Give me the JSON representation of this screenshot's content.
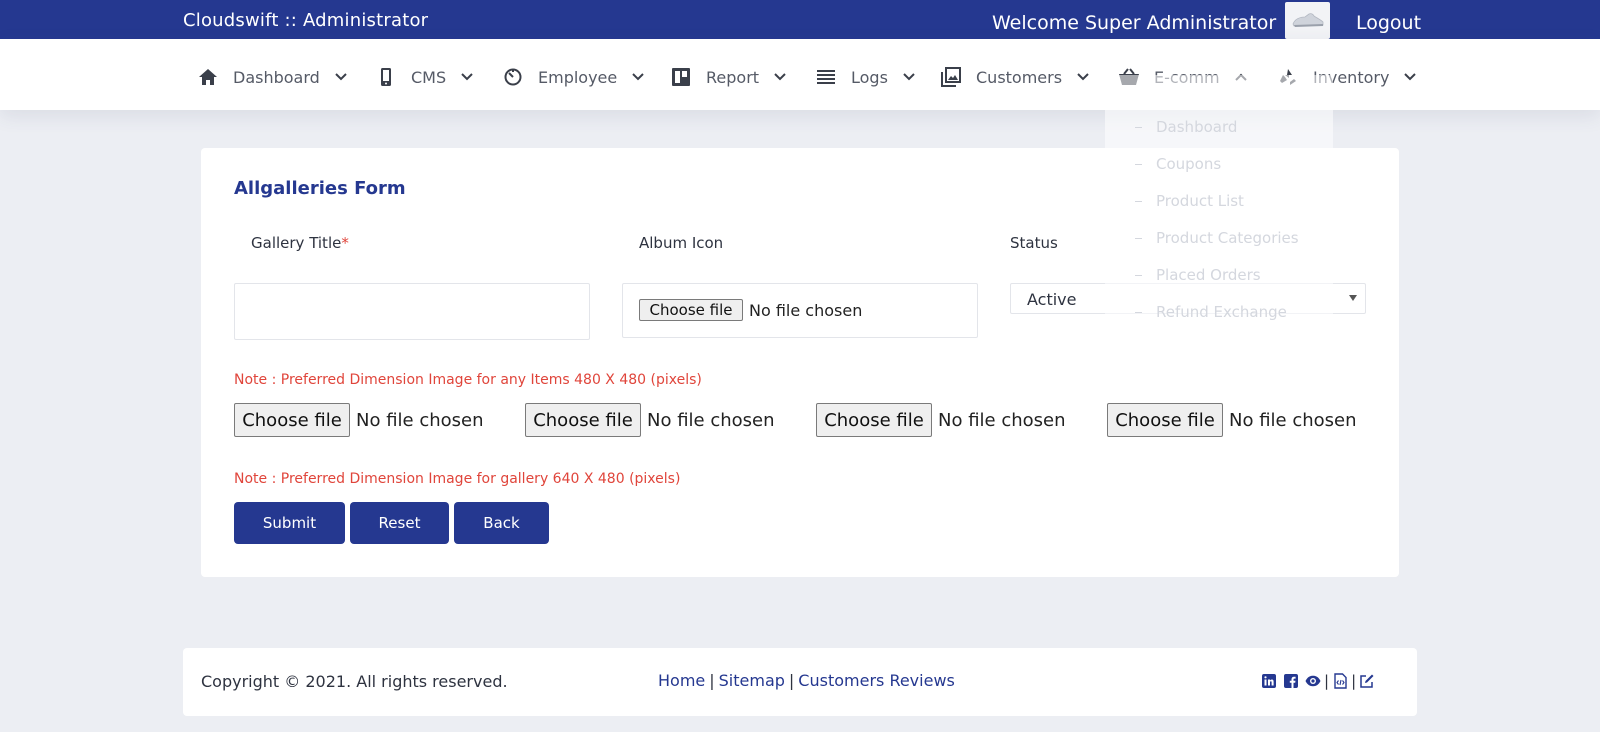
{
  "header": {
    "brand": "Cloudswift :: Administrator",
    "welcome": "Welcome Super Administrator",
    "logout": "Logout"
  },
  "nav": {
    "items": [
      {
        "label": "Dashboard",
        "icon": "home-icon"
      },
      {
        "label": "CMS",
        "icon": "mobile-icon"
      },
      {
        "label": "Employee",
        "icon": "timer-icon"
      },
      {
        "label": "Report",
        "icon": "board-icon"
      },
      {
        "label": "Logs",
        "icon": "list-icon"
      },
      {
        "label": "Customers",
        "icon": "gallery-icon"
      },
      {
        "label": "E-comm",
        "icon": "basket-icon"
      },
      {
        "label": "Inventory",
        "icon": "recycle-icon"
      }
    ],
    "ecomm_dropdown": [
      "Dashboard",
      "Coupons",
      "Product List",
      "Product Categories",
      "Placed Orders",
      "Refund Exchange"
    ]
  },
  "form": {
    "title": "Allgalleries Form",
    "gallery_title_label": "Gallery Title",
    "required_mark": "*",
    "album_icon_label": "Album Icon",
    "status_label": "Status",
    "status_value": "Active",
    "choose_file": "Choose file",
    "no_file": "No file chosen",
    "note_items": "Note : Preferred Dimension Image for any Items 480 X 480 (pixels)",
    "note_gallery": "Note : Preferred Dimension Image for gallery 640 X 480 (pixels)",
    "submit": "Submit",
    "reset": "Reset",
    "back": "Back"
  },
  "footer": {
    "copyright": "Copyright © 2021. All rights reserved.",
    "links": [
      "Home",
      "Sitemap",
      "Customers Reviews"
    ],
    "separator": "|",
    "social_icons": [
      "linkedin-icon",
      "facebook-icon",
      "eye-icon",
      "code-file-icon",
      "edit-icon"
    ]
  },
  "colors": {
    "primary": "#253890",
    "note": "#e0453b",
    "background": "#eceef3"
  }
}
